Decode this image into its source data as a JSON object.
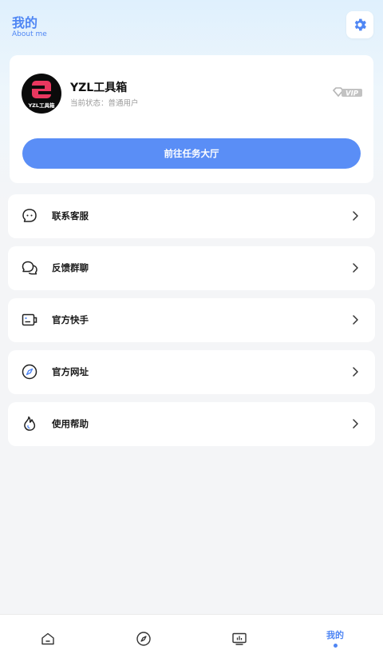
{
  "header": {
    "title": "我的",
    "subtitle": "About me",
    "settings_icon": "gear-icon"
  },
  "profile": {
    "avatar_text": "YZL工具箱",
    "name": "YZL工具箱",
    "status_label": "当前状态：",
    "status_value": "普通用户",
    "badge": "VIP",
    "cta_label": "前往任务大厅"
  },
  "menu": {
    "items": [
      {
        "label": "联系客服",
        "icon": "chat-bubble-icon"
      },
      {
        "label": "反馈群聊",
        "icon": "group-chat-icon"
      },
      {
        "label": "官方快手",
        "icon": "card-icon"
      },
      {
        "label": "官方网址",
        "icon": "compass-icon"
      },
      {
        "label": "使用帮助",
        "icon": "flame-icon"
      }
    ]
  },
  "tabbar": {
    "tabs": [
      {
        "label": "",
        "icon": "home-icon"
      },
      {
        "label": "",
        "icon": "compass-icon"
      },
      {
        "label": "",
        "icon": "monitor-chart-icon"
      },
      {
        "label": "我的",
        "icon": "",
        "active": true
      }
    ]
  },
  "colors": {
    "accent": "#4f86f4",
    "button": "#5a8ef6",
    "background": "#f4f5f7"
  }
}
